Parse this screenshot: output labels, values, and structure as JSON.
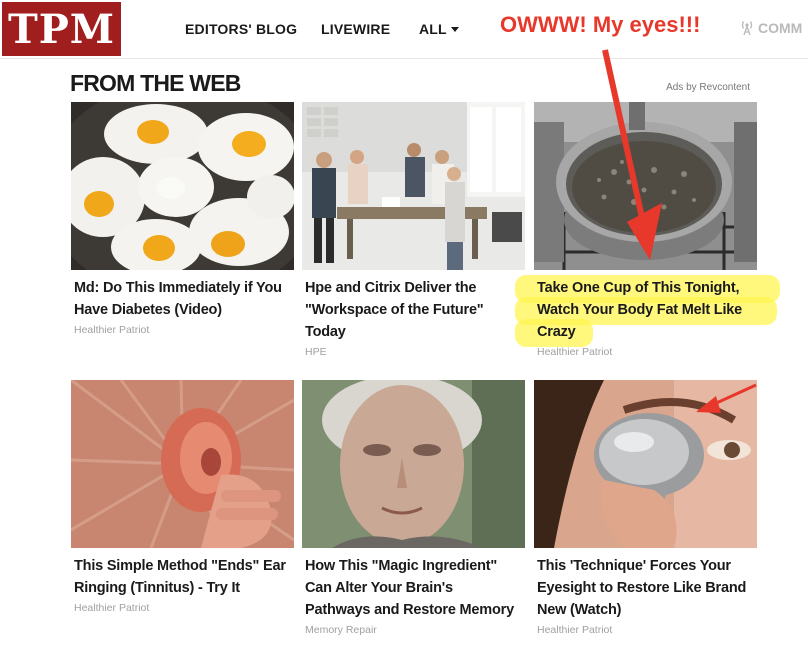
{
  "brand": {
    "logo_text": "TPM",
    "logo_color": "#a11e1e"
  },
  "nav": {
    "items": [
      {
        "label": "EDITORS' BLOG"
      },
      {
        "label": "LIVEWIRE"
      },
      {
        "label": "ALL"
      }
    ],
    "overflow_label": "COMM"
  },
  "annotation": {
    "text": "OWWW! My eyes!!!",
    "color": "#e8382b",
    "highlight_color": "#fff550"
  },
  "section": {
    "title": "FROM THE WEB",
    "ads_credit": "Ads by Revcontent"
  },
  "cards": [
    {
      "headline": "Md: Do This Immediately if You Have Diabetes (Video)",
      "source": "Healthier Patriot",
      "image": "fried-eggs-in-pan"
    },
    {
      "headline": "Hpe and Citrix Deliver the \"Workspace of the Future\" Today",
      "source": "HPE",
      "image": "office-team-meeting"
    },
    {
      "headline": "Take One Cup of This Tonight, Watch Your Body Fat Melt Like Crazy",
      "source": "Healthier Patriot",
      "image": "pot-with-dried-herbs",
      "highlighted": true
    },
    {
      "headline": "This Simple Method \"Ends\" Ear Ringing (Tinnitus) - Try It",
      "source": "Healthier Patriot",
      "image": "ear-closeup"
    },
    {
      "headline": "How This \"Magic Ingredient\" Can Alter Your Brain's Pathways and Restore Memory",
      "source": "Memory Repair",
      "image": "elderly-woman-portrait"
    },
    {
      "headline": "This 'Technique' Forces Your Eyesight to Restore Like Brand New (Watch)",
      "source": "Healthier Patriot",
      "image": "spoon-over-eye"
    }
  ]
}
